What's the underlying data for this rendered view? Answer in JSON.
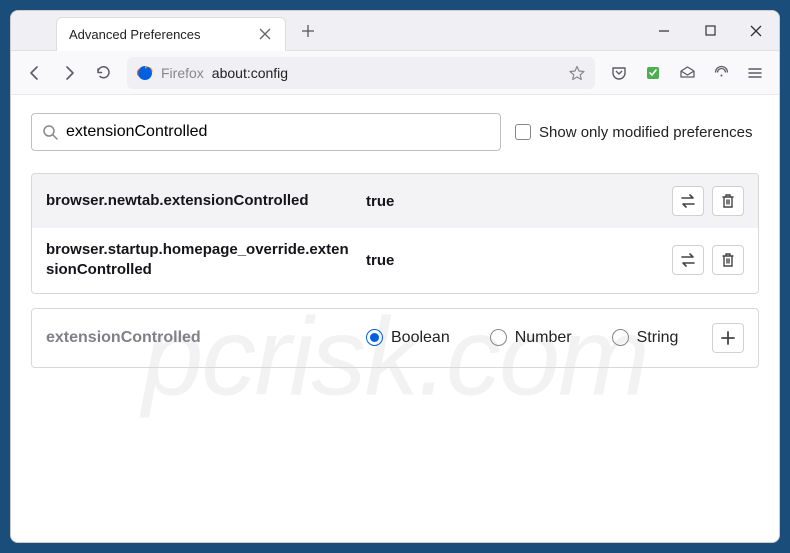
{
  "window": {
    "tab_title": "Advanced Preferences",
    "url_label": "Firefox",
    "url": "about:config"
  },
  "search": {
    "value": "extensionControlled",
    "placeholder": "",
    "checkbox_label": "Show only modified preferences"
  },
  "prefs": [
    {
      "name": "browser.newtab.extensionControlled",
      "value": "true"
    },
    {
      "name": "browser.startup.homepage_override.extensionControlled",
      "value": "true"
    }
  ],
  "add": {
    "name": "extensionControlled",
    "types": [
      "Boolean",
      "Number",
      "String"
    ],
    "selected": "Boolean"
  },
  "watermark": "pcrisk.com"
}
